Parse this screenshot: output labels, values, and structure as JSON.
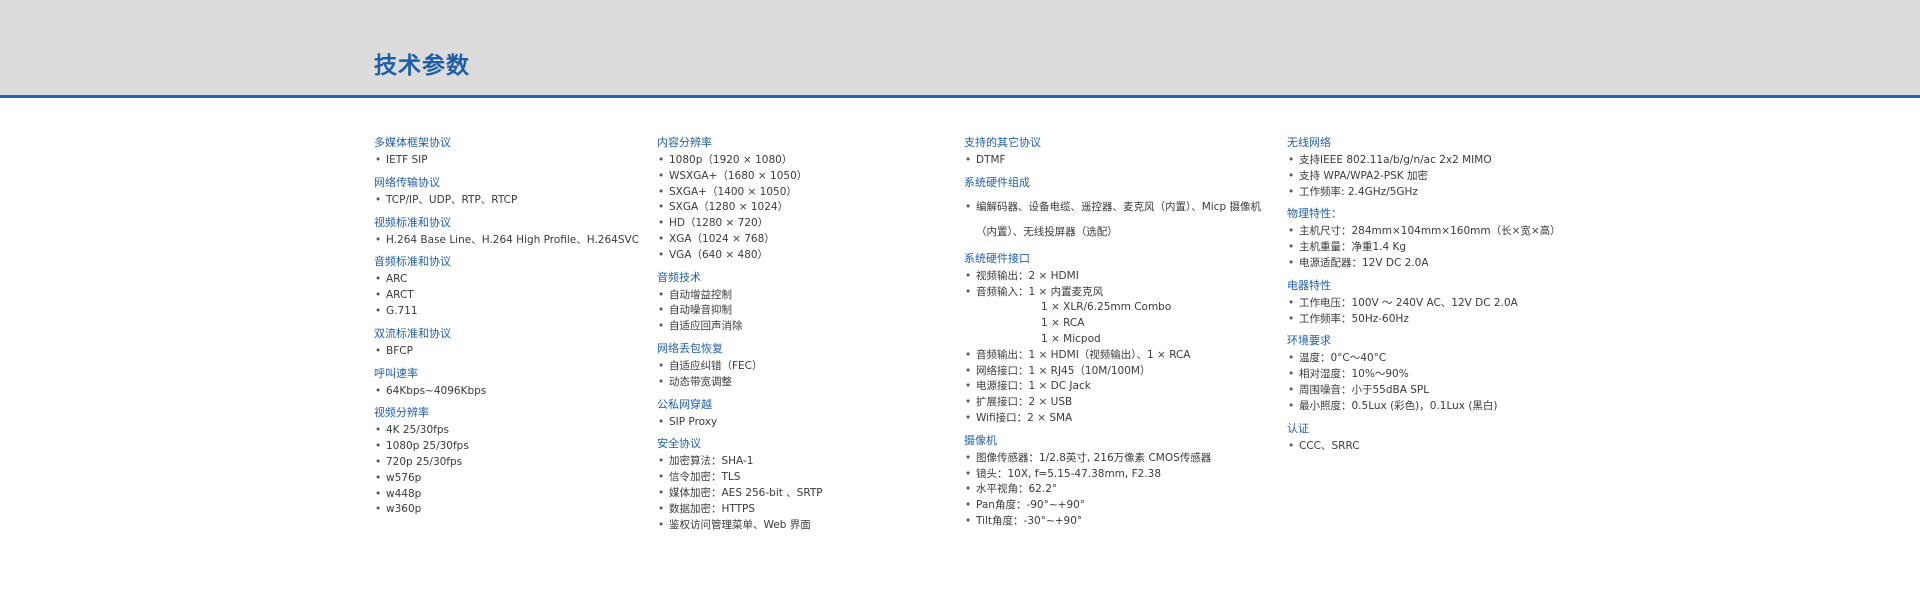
{
  "page": {
    "title": "技术参数"
  },
  "columns": [
    {
      "sections": [
        {
          "heading": "多媒体框架协议",
          "items": [
            "IETF SIP"
          ]
        },
        {
          "heading": "网络传输协议",
          "items": [
            "TCP/IP、UDP、RTP、RTCP"
          ]
        },
        {
          "heading": "视频标准和协议",
          "items": [
            "H.264 Base Line、H.264 High Profile、H.264SVC"
          ]
        },
        {
          "heading": "音频标准和协议",
          "items": [
            "ARC",
            "ARCT",
            "G.711"
          ]
        },
        {
          "heading": "双流标准和协议",
          "items": [
            "BFCP"
          ]
        },
        {
          "heading": "呼叫速率",
          "items": [
            "64Kbps~4096Kbps"
          ]
        },
        {
          "heading": "视频分辨率",
          "items": [
            "4K 25/30fps",
            "1080p 25/30fps",
            "720p 25/30fps",
            "w576p",
            "w448p",
            "w360p"
          ]
        }
      ]
    },
    {
      "sections": [
        {
          "heading": "内容分辨率",
          "items": [
            "1080p（1920 × 1080）",
            "WSXGA+（1680 × 1050）",
            "SXGA+（1400 × 1050）",
            "SXGA（1280 × 1024）",
            "HD（1280 × 720）",
            "XGA（1024 × 768）",
            "VGA（640 × 480）"
          ]
        },
        {
          "heading": "音频技术",
          "items": [
            "自动增益控制",
            "自动噪音抑制",
            "自适应回声消除"
          ]
        },
        {
          "heading": "网络丢包恢复",
          "items": [
            "自适应纠错（FEC）",
            "动态带宽调整"
          ]
        },
        {
          "heading": "公私网穿越",
          "items": [
            "SIP Proxy"
          ]
        },
        {
          "heading": "安全协议",
          "items": [
            "加密算法：SHA-1",
            "信令加密：TLS",
            "媒体加密：AES 256-bit 、SRTP",
            "数据加密：HTTPS",
            "鉴权访问管理菜单、Web 界面"
          ]
        }
      ]
    },
    {
      "sections": [
        {
          "heading": "支持的其它协议",
          "items": [
            "DTMF"
          ]
        },
        {
          "heading": "系统硬件组成",
          "items": [
            "编解码器、设备电缆、遥控器、麦克风（内置）、Micp 摄像机（内置）、无线投屏器（选配）"
          ]
        },
        {
          "heading": "系统硬件接口",
          "items": [
            "视频输出：2 × HDMI",
            "音频输入：1 × 内置麦克风",
            "1 × XLR/6.25mm Combo",
            "1 × RCA",
            "1 × Micpod",
            "音频输出：1 × HDMI（视频输出）、1 × RCA",
            "网络接口：1 × RJ45（10M/100M）",
            "电源接口：1 × DC Jack",
            "扩展接口：2 × USB",
            "Wifi接口：2 × SMA"
          ]
        },
        {
          "heading": "摄像机",
          "items": [
            "图像传感器：1/2.8英寸, 216万像素 CMOS传感器",
            "镜头：10X, f=5.15-47.38mm, F2.38",
            "水平视角：62.2°",
            "Pan角度：-90°~+90°",
            "Tilt角度：-30°~+90°"
          ]
        }
      ]
    },
    {
      "sections": [
        {
          "heading": "无线网络",
          "items": [
            "支持IEEE 802.11a/b/g/n/ac 2x2 MIMO",
            "支持 WPA/WPA2-PSK 加密",
            "工作频率: 2.4GHz/5GHz"
          ]
        },
        {
          "heading": "物理特性：",
          "items": [
            "主机尺寸：284mm×104mm×160mm（长×宽×高）",
            "主机重量：净重1.4 Kg",
            "电源适配器：12V DC 2.0A"
          ]
        },
        {
          "heading": "电器特性",
          "items": [
            "工作电压：100V ～ 240V AC、12V DC 2.0A",
            "工作频率：50Hz-60Hz"
          ]
        },
        {
          "heading": "环境要求",
          "items": [
            "温度：0°C～40°C",
            "相对湿度：10%～90%",
            "周围噪音：小于55dBA SPL",
            "最小照度：0.5Lux (彩色)，0.1Lux (黑白)"
          ]
        },
        {
          "heading": "认证",
          "items": [
            "CCC、SRRC"
          ]
        }
      ]
    }
  ]
}
